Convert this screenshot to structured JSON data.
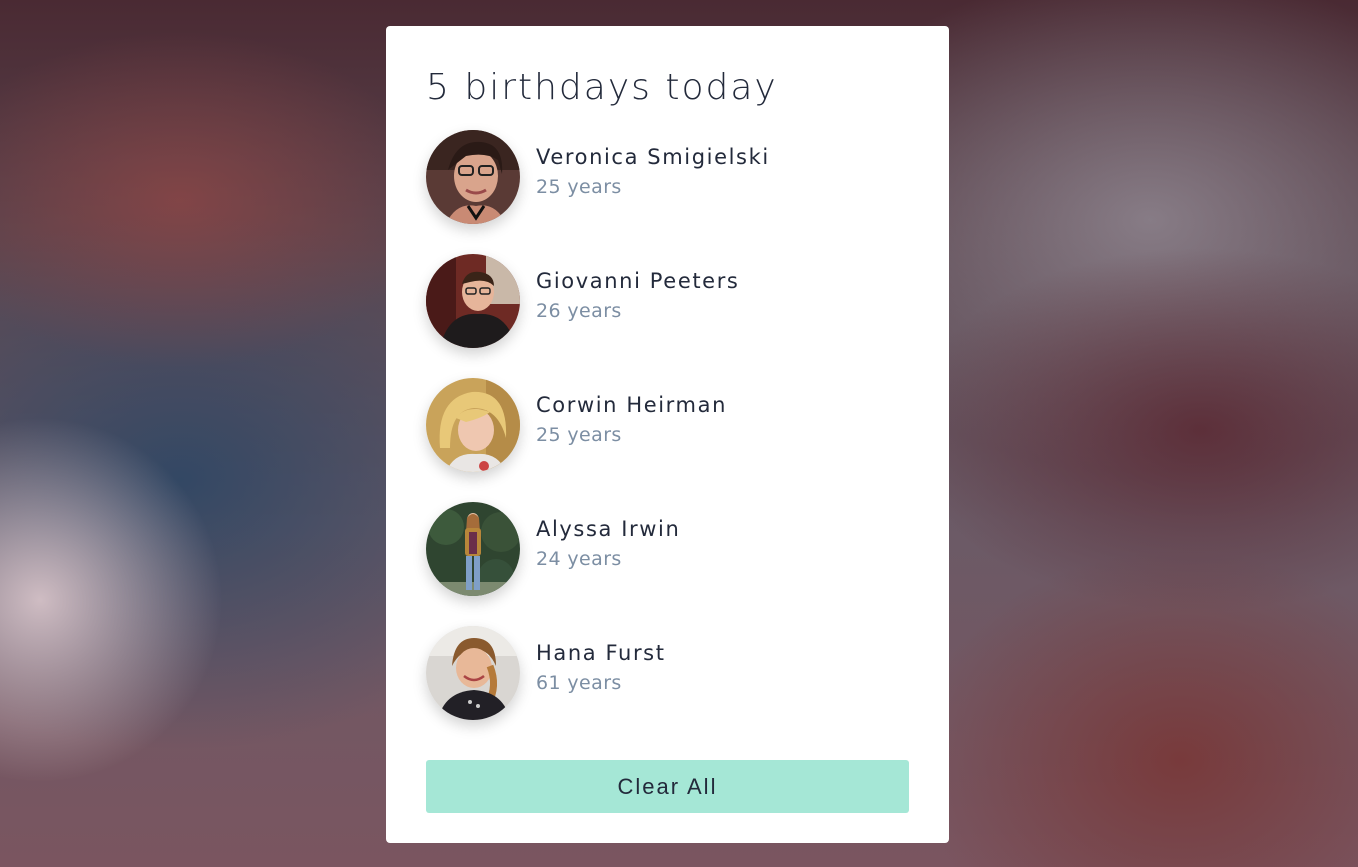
{
  "header": {
    "title": "5 birthdays today"
  },
  "people": [
    {
      "name": "Veronica Smigielski",
      "age_label": "25 years",
      "avatar_icon": "person-photo-icon"
    },
    {
      "name": "Giovanni Peeters",
      "age_label": "26 years",
      "avatar_icon": "person-photo-icon"
    },
    {
      "name": "Corwin Heirman",
      "age_label": "25 years",
      "avatar_icon": "person-photo-icon"
    },
    {
      "name": "Alyssa Irwin",
      "age_label": "24 years",
      "avatar_icon": "person-photo-icon"
    },
    {
      "name": "Hana Furst",
      "age_label": "61 years",
      "avatar_icon": "person-photo-icon"
    }
  ],
  "actions": {
    "clear_all_label": "Clear All"
  },
  "colors": {
    "accent_button": "#a5e7d6",
    "text_primary": "#232a3b",
    "text_secondary": "#7c8ea3",
    "card_background": "#ffffff"
  }
}
